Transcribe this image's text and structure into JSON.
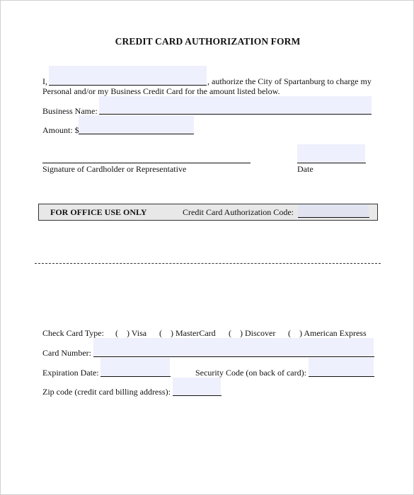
{
  "form": {
    "title": "CREDIT CARD AUTHORIZATION FORM",
    "intro": {
      "prefix": "I,",
      "name_field_value": "",
      "suffix": ", authorize the City of Spartanburg to charge my",
      "line2": "Personal and/or my Business Credit Card for the amount listed below."
    },
    "business_name": {
      "label": "Business Name:",
      "value": ""
    },
    "amount": {
      "label": "Amount: $",
      "value": ""
    },
    "signature": {
      "label": "Signature of Cardholder or Representative"
    },
    "date": {
      "label": "Date",
      "value": ""
    },
    "office": {
      "heading": "FOR OFFICE USE ONLY",
      "auth_code_label": "Credit Card Authorization Code:",
      "auth_code_value": ""
    },
    "card_type": {
      "label": "Check Card Type:",
      "options": [
        {
          "mark": "(    )",
          "label": "Visa"
        },
        {
          "mark": "(    )",
          "label": "MasterCard"
        },
        {
          "mark": "(    )",
          "label": "Discover"
        },
        {
          "mark": "(    )",
          "label": "American Express"
        }
      ]
    },
    "card_number": {
      "label": "Card Number:",
      "value": ""
    },
    "expiration_date": {
      "label": "Expiration Date:",
      "value": ""
    },
    "security_code": {
      "label": "Security Code (on back of card):",
      "value": ""
    },
    "zip_code": {
      "label": "Zip code (credit card billing address):",
      "value": ""
    }
  },
  "colors": {
    "field_fill": "#eef0fd",
    "office_box_fill": "#e8e8e8"
  }
}
